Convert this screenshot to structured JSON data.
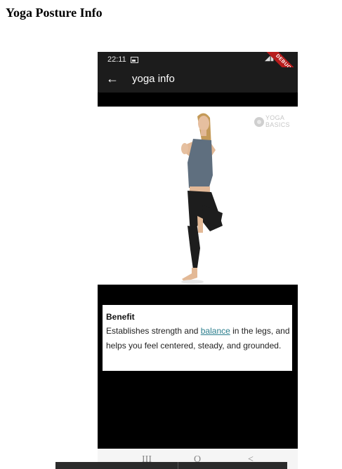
{
  "page": {
    "title": "Yoga Posture Info"
  },
  "status_bar": {
    "time": "22:11",
    "debug_label": "DEBUG"
  },
  "app_bar": {
    "back_icon": "←",
    "title": "yoga info"
  },
  "watermark": {
    "line1": "YOGA",
    "line2": "BASICS"
  },
  "info_card": {
    "title": "Benefit",
    "text_before": "Establishes strength and ",
    "link": "balance",
    "text_after": " in the legs, and helps you feel centered, steady, and grounded."
  },
  "nav_bar": {
    "recents": "III",
    "home": "O",
    "back": "<"
  }
}
